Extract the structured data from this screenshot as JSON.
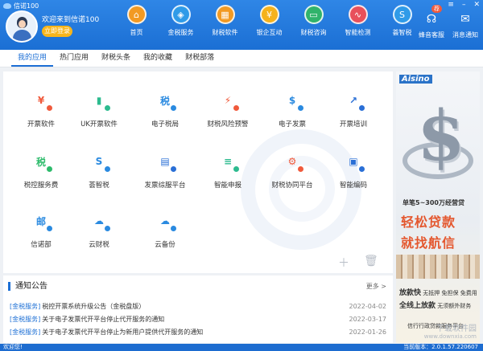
{
  "window": {
    "title": "信诺100"
  },
  "user": {
    "welcome": "欢迎来到信诺100",
    "login_label": "立即登录"
  },
  "nav": [
    {
      "label": "首页",
      "icon": "home-icon",
      "glyph": "⌂",
      "color": "#f29a23"
    },
    {
      "label": "金税服务",
      "icon": "tax-service-icon",
      "glyph": "◈",
      "color": "#2f9be8"
    },
    {
      "label": "财税软件",
      "icon": "software-grid-icon",
      "glyph": "▦",
      "color": "#f29a23"
    },
    {
      "label": "银企互动",
      "icon": "bank-icon",
      "glyph": "¥",
      "color": "#f5b21b"
    },
    {
      "label": "财税咨询",
      "icon": "tv-consult-icon",
      "glyph": "▭",
      "color": "#30b36b"
    },
    {
      "label": "智能检测",
      "icon": "monitor-icon",
      "glyph": "∿",
      "color": "#e8505b"
    },
    {
      "label": "荟智税",
      "icon": "brand-s-icon",
      "glyph": "S",
      "color": "#2f9be8"
    }
  ],
  "tools": [
    {
      "label": "蜂音客服",
      "icon": "customer-service-icon",
      "glyph": "☊",
      "badge": "荐"
    },
    {
      "label": "消息通知",
      "icon": "message-icon",
      "glyph": "✉",
      "badge": ""
    }
  ],
  "tabs": [
    "我的应用",
    "热门应用",
    "财税头条",
    "我的收藏",
    "财税部落"
  ],
  "apps": [
    {
      "label": "开票软件",
      "icon": "invoice-software-icon",
      "glyph": "¥",
      "color": "#f05a3c"
    },
    {
      "label": "UK开票软件",
      "icon": "ukey-icon",
      "glyph": "▮",
      "color": "#2dbb8f"
    },
    {
      "label": "电子税局",
      "icon": "e-tax-icon",
      "glyph": "税",
      "color": "#2a8ae0"
    },
    {
      "label": "财税风险预警",
      "icon": "risk-warning-icon",
      "glyph": "⚡",
      "color": "#f05a3c"
    },
    {
      "label": "电子发票",
      "icon": "e-invoice-icon",
      "glyph": "$",
      "color": "#2a8ae0"
    },
    {
      "label": "开票培训",
      "icon": "training-icon",
      "glyph": "↗",
      "color": "#2a6fd6"
    },
    {
      "label": "税控服务费",
      "icon": "tax-fee-icon",
      "glyph": "税",
      "color": "#2dbb6b"
    },
    {
      "label": "荟智税",
      "icon": "huizhi-icon",
      "glyph": "S",
      "color": "#2a8ae0"
    },
    {
      "label": "发票综服平台",
      "icon": "invoice-platform-icon",
      "glyph": "▤",
      "color": "#2a6fd6"
    },
    {
      "label": "智能申报",
      "icon": "smart-declare-icon",
      "glyph": "≡",
      "color": "#2dbb8f"
    },
    {
      "label": "财税协同平台",
      "icon": "collab-icon",
      "glyph": "⚙",
      "color": "#f05a3c"
    },
    {
      "label": "智能编码",
      "icon": "smart-code-icon",
      "glyph": "▣",
      "color": "#2a6fd6"
    },
    {
      "label": "信诺部",
      "icon": "truck-icon",
      "glyph": "邮",
      "color": "#2a8ae0"
    },
    {
      "label": "云财税",
      "icon": "cloud-tax-icon",
      "glyph": "☁",
      "color": "#2a8ae0"
    },
    {
      "label": "云备份",
      "icon": "cloud-backup-icon",
      "glyph": "☁",
      "color": "#2a8ae0"
    }
  ],
  "notices": {
    "title": "通知公告",
    "more": "更多 >",
    "items": [
      {
        "tag": "[金税服务]",
        "text": "税控开票系统升级公告（金税盘版）",
        "date": "2022-04-02"
      },
      {
        "tag": "[金税服务]",
        "text": "关于电子发票代开平台停止代开服务的通知",
        "date": "2022-03-17"
      },
      {
        "tag": "[金税服务]",
        "text": "关于电子发票代开平台停止为新用户提供代开服务的通知",
        "date": "2022-01-26"
      }
    ]
  },
  "ad": {
    "brand": "Aisino",
    "small": "单笔5~300万经营贷",
    "big1": "轻松贷款",
    "big2": "就找航信",
    "row1": {
      "main": "放款快",
      "tags": "无抵押  免担保  免费用"
    },
    "row2": {
      "main": "全线上放款",
      "tags": "无须额外财务"
    },
    "row3": "信行行政贷款服务平台"
  },
  "watermark": {
    "name": "下载软件园",
    "url": "www.downxia.com"
  },
  "status": {
    "left": "欢迎您!",
    "version": "当前版本：2.0.1.57.220607"
  }
}
